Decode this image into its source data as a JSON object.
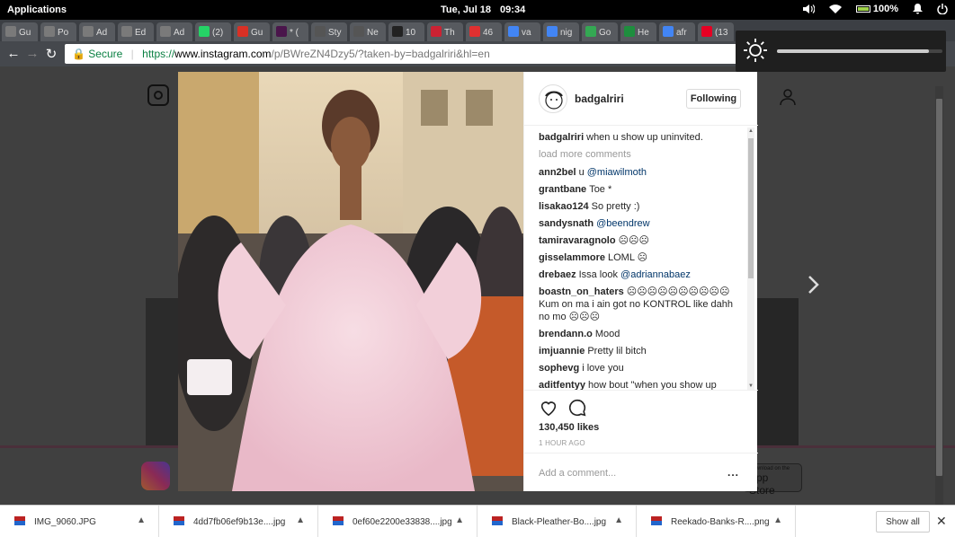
{
  "topbar": {
    "applications": "Applications",
    "date": "Tue, Jul 18",
    "time": "09:34",
    "battery": "100%"
  },
  "tabs": [
    {
      "label": "Gu",
      "favicon": "shirt-icon",
      "color": "#7a7a7a"
    },
    {
      "label": "Po",
      "favicon": "shirt-icon",
      "color": "#7a7a7a"
    },
    {
      "label": "Ad",
      "favicon": "shirt-icon",
      "color": "#7a7a7a"
    },
    {
      "label": "Ed",
      "favicon": "shirt-icon",
      "color": "#7a7a7a"
    },
    {
      "label": "Ad",
      "favicon": "shirt-icon",
      "color": "#7a7a7a"
    },
    {
      "label": "(2)",
      "favicon": "whatsapp-icon",
      "color": "#25d366"
    },
    {
      "label": "Gu",
      "favicon": "gmail-icon",
      "color": "#d93025"
    },
    {
      "label": "* (",
      "favicon": "slack-icon",
      "color": "#4a154b"
    },
    {
      "label": "Sty",
      "favicon": "kaggle-icon",
      "color": "#555555"
    },
    {
      "label": "Ne",
      "favicon": "kaggle-icon",
      "color": "#555555"
    },
    {
      "label": "10",
      "favicon": "s-icon",
      "color": "#222222"
    },
    {
      "label": "Th",
      "favicon": "is-icon",
      "color": "#cc2233"
    },
    {
      "label": "46",
      "favicon": "strava-icon",
      "color": "#e03030"
    },
    {
      "label": "va",
      "favicon": "google-icon",
      "color": "#4285f4"
    },
    {
      "label": "nig",
      "favicon": "google-icon",
      "color": "#4285f4"
    },
    {
      "label": "Go",
      "favicon": "leaf-icon",
      "color": "#34a853"
    },
    {
      "label": "He",
      "favicon": "n-icon",
      "color": "#1e8e3e"
    },
    {
      "label": "afr",
      "favicon": "google-icon",
      "color": "#4285f4"
    },
    {
      "label": "(13",
      "favicon": "pinterest-icon",
      "color": "#e60023"
    }
  ],
  "addressbar": {
    "secure_label": "Secure",
    "url_scheme": "https://",
    "url_host": "www.instagram.com",
    "url_path": "/p/BWreZN4Dzy5/?taken-by=badgalriri&hl=en"
  },
  "brightness": {
    "level": 0.92
  },
  "post": {
    "username": "badgalriri",
    "follow_label": "Following",
    "caption_user": "badgalriri",
    "caption_text": "when u show up uninvited.",
    "load_more": "load more comments",
    "comments": [
      {
        "user": "ann2bel",
        "text": "u ",
        "mention": "@miawilmoth"
      },
      {
        "user": "grantbane",
        "text": "Toe *",
        "mention": ""
      },
      {
        "user": "lisakao124",
        "text": "So pretty :)",
        "mention": ""
      },
      {
        "user": "sandysnath",
        "text": "",
        "mention": "@beendrew"
      },
      {
        "user": "tamiravaragnolo",
        "text": "☹☹☹",
        "mention": ""
      },
      {
        "user": "gisselammore",
        "text": "LOML ☹",
        "mention": ""
      },
      {
        "user": "drebaez",
        "text": "Issa look ",
        "mention": "@adriannabaez"
      },
      {
        "user": "boastn_on_haters",
        "text": "☹☹☹☹☹☹☹☹☹☹ Kum on ma i ain got no KONTROL like dahh no mo ☹☹☹",
        "mention": ""
      },
      {
        "user": "brendann.o",
        "text": "Mood",
        "mention": ""
      },
      {
        "user": "imjuannie",
        "text": "Pretty lil bitch",
        "mention": ""
      },
      {
        "user": "sophevg",
        "text": "i love you",
        "mention": ""
      },
      {
        "user": "aditfentyy",
        "text": "how bout \"when you show up",
        "mention": ""
      }
    ],
    "likes": "130,450 likes",
    "time_ago": "1 HOUR AGO",
    "comment_placeholder": "Add a comment...",
    "more_label": "..."
  },
  "background": {
    "app_store_small": "Download on the",
    "app_store": "App Store"
  },
  "downloads": {
    "items": [
      {
        "name": "IMG_9060.JPG"
      },
      {
        "name": "4dd7fb06ef9b13e....jpg"
      },
      {
        "name": "0ef60e2200e33838....jpg"
      },
      {
        "name": "Black-Pleather-Bo....jpg"
      },
      {
        "name": "Reekado-Banks-R....png"
      }
    ],
    "show_all": "Show all"
  }
}
